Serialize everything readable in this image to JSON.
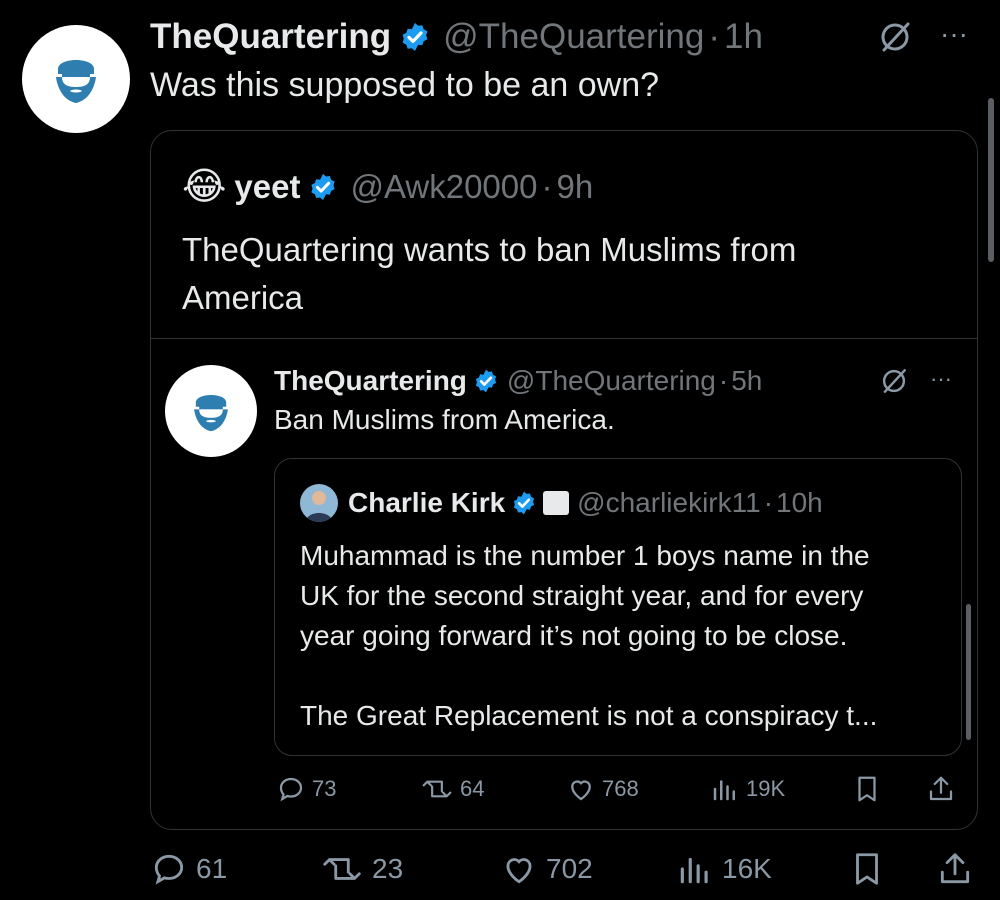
{
  "main_tweet": {
    "author_name": "TheQuartering",
    "handle": "@TheQuartering",
    "time": "1h",
    "text": "Was this supposed to be an own?",
    "actions": {
      "replies": "61",
      "reposts": "23",
      "likes": "702",
      "views": "16K"
    }
  },
  "quoted_tweet": {
    "author_name": "yeet",
    "handle": "@Awk20000",
    "time": "9h",
    "avatar_emoji": "😂",
    "text_line1": "TheQuartering wants to ban Muslims from",
    "text_line2": "America"
  },
  "inner_tweet": {
    "author_name": "TheQuartering",
    "handle": "@TheQuartering",
    "time": "5h",
    "text": "Ban Muslims from America.",
    "actions": {
      "replies": "73",
      "reposts": "64",
      "likes": "768",
      "views": "19K"
    }
  },
  "innermost_tweet": {
    "author_name": "Charlie Kirk",
    "handle": "@charliekirk11",
    "time": "10h",
    "lines": [
      "Muhammad is the number 1 boys name in the",
      "UK for the second straight year, and for every",
      "year going forward it’s not going to be close.",
      "The Great Replacement is not a conspiracy t..."
    ]
  },
  "separator": "·",
  "more_menu": "···",
  "colors": {
    "verified": "#1d9bf0",
    "avatar_brand": "#2e7fb0",
    "text": "#e7e9ea",
    "muted": "#71767b"
  },
  "icons": [
    "grok-slash-icon",
    "more-icon",
    "reply-icon",
    "repost-icon",
    "like-icon",
    "views-icon",
    "bookmark-icon",
    "share-icon",
    "verified-icon"
  ]
}
